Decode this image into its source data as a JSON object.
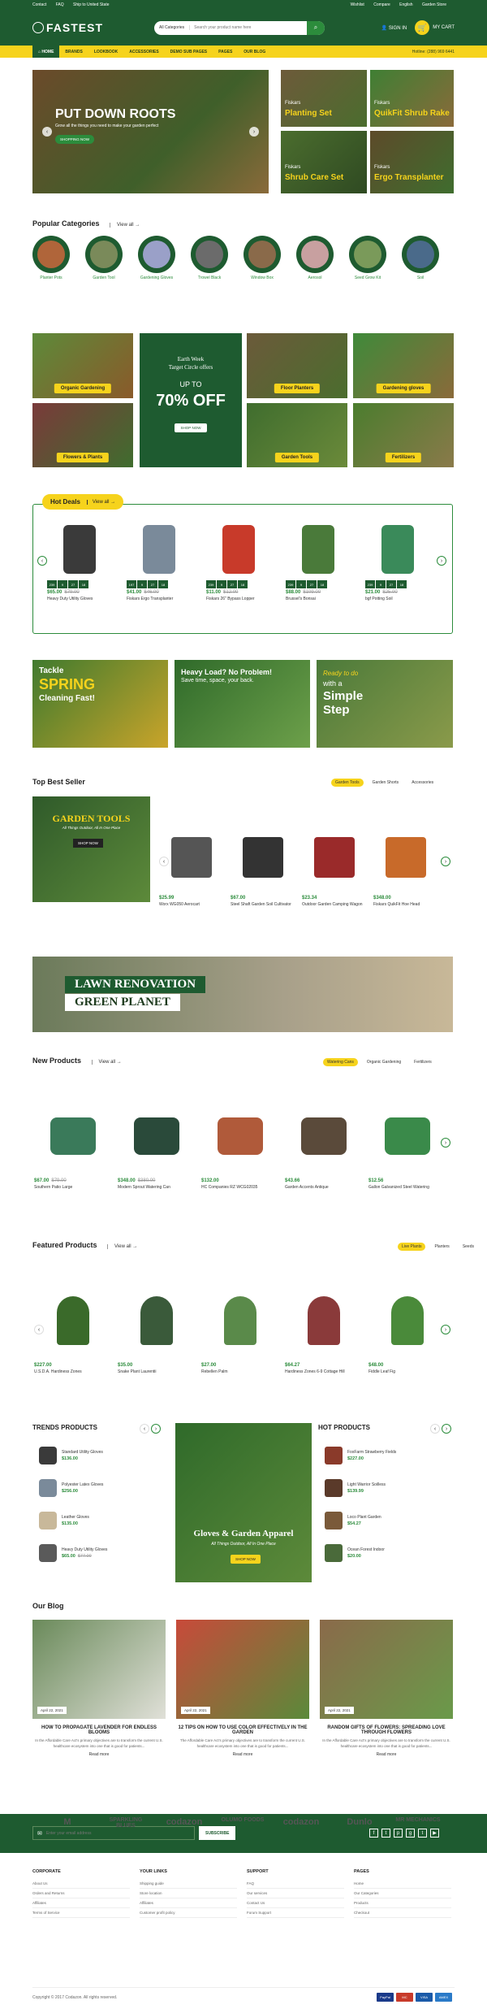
{
  "topbar": {
    "contact": "Contact",
    "faq": "FAQ",
    "ship": "Ship to United State",
    "wishlist": "Wishlist",
    "compare": "Compare",
    "language": "English",
    "store": "Garden Store"
  },
  "header": {
    "logo": "FASTEST",
    "search_category": "All Categories",
    "search_placeholder": "Search your product name here",
    "signin": "SIGN IN",
    "cart": "MY CART"
  },
  "nav": {
    "items": [
      "HOME",
      "BRANDS",
      "LOOKBOOK",
      "ACCESSORIES",
      "DEMO SUB PAGES",
      "PAGES",
      "OUR BLOG"
    ],
    "phone": "Hotline: (288) 969 6441"
  },
  "hero": {
    "title": "PUT DOWN ROOTS",
    "subtitle": "Grow all the things you need to make your garden perfect",
    "button": "SHOPPING NOW"
  },
  "side_tiles": [
    {
      "brand": "Fiskars",
      "label": "Planting Set"
    },
    {
      "brand": "Fiskars",
      "label": "QuikFit Shrub Rake"
    },
    {
      "brand": "Fiskars",
      "label": "Shrub Care Set"
    },
    {
      "brand": "Fiskars",
      "label": "Ergo Transplanter"
    }
  ],
  "popular": {
    "title": "Popular Categories",
    "view_all": "View all",
    "items": [
      "Planter Pots",
      "Garden Tool",
      "Gardening Gloves",
      "Trowel Black",
      "Window Box",
      "Aerosol",
      "Seed Grow Kit",
      "Soil"
    ]
  },
  "promo_tiles": [
    "Organic Gardening",
    "Floor Planters",
    "Gardening gloves",
    "Flowers & Plants",
    "Garden Tools",
    "Fertilizers"
  ],
  "promo": {
    "line1": "Earth Week",
    "line2": "Target Circle offers",
    "upto": "UP TO",
    "off": "70% OFF",
    "button": "SHOP NOW"
  },
  "hot_deals": {
    "title": "Hot Deals",
    "view_all": "View all",
    "countdown_labels": [
      "Days",
      "Hours",
      "Mins",
      "Secs"
    ],
    "items": [
      {
        "price": "$65.00",
        "old": "$79.00",
        "name": "Heavy Duty Utility Gloves",
        "cd": [
          "239",
          "9",
          "27",
          "18"
        ]
      },
      {
        "price": "$41.00",
        "old": "$46.00",
        "name": "Fiskars Ergo Transplanter",
        "cd": [
          "197",
          "9",
          "27",
          "18"
        ]
      },
      {
        "price": "$11.00",
        "old": "$12.00",
        "name": "Fiskars 26\" Bypass Lopper",
        "cd": [
          "239",
          "9",
          "27",
          "18"
        ]
      },
      {
        "price": "$88.00",
        "old": "$109.00",
        "name": "Brussel's Bonsai",
        "cd": [
          "239",
          "9",
          "27",
          "18"
        ]
      },
      {
        "price": "$21.00",
        "old": "$25.00",
        "name": "bgf Potting Soil",
        "cd": [
          "239",
          "9",
          "27",
          "18"
        ]
      }
    ]
  },
  "banners3": [
    {
      "a": "Tackle",
      "b": "SPRING",
      "c": "Cleaning Fast!"
    },
    {
      "a": "Heavy Load? No Problem!",
      "b": "Save time, space, your back."
    },
    {
      "a": "Ready to do",
      "b": "with a",
      "c": "Simple Step"
    }
  ],
  "best": {
    "title": "Top Best Seller",
    "tabs": [
      "Garden Tools",
      "Garden Shorts",
      "Accessories"
    ],
    "banner_title": "GARDEN TOOLS",
    "banner_sub": "All Things Outdoor, All In One Place",
    "banner_btn": "SHOP NOW",
    "items": [
      {
        "price": "$25.99",
        "name": "Worx WG050 Aerocart"
      },
      {
        "price": "$67.00",
        "name": "Steel Shaft Garden Soil Cultivator"
      },
      {
        "price": "$23.34",
        "name": "Outdoor Garden Camping Wagon"
      },
      {
        "price": "$348.00",
        "name": "Fiskars QuikFit Hoe Head"
      }
    ]
  },
  "lawn": {
    "l1": "LAWN RENOVATION",
    "l2": "GREEN PLANET"
  },
  "newp": {
    "title": "New Products",
    "view_all": "View all",
    "tabs": [
      "Watering Cans",
      "Organic Gardening",
      "Fertilizers"
    ],
    "items": [
      {
        "price": "$67.00",
        "old": "$79.00",
        "name": "Southern Patio Large"
      },
      {
        "price": "$348.00",
        "old": "$380.00",
        "name": "Modern Sprout Watering Can"
      },
      {
        "price": "$132.00",
        "old": "",
        "name": "HC Companies RZ WCG02035"
      },
      {
        "price": "$43.66",
        "old": "",
        "name": "Garden Accents Antique"
      },
      {
        "price": "$12.56",
        "old": "",
        "name": "Gallon Galvanized Steel Watering"
      }
    ]
  },
  "featured": {
    "title": "Featured Products",
    "view_all": "View all",
    "tabs": [
      "Live Plants",
      "Planters",
      "Seeds"
    ],
    "items": [
      {
        "price": "$227.00",
        "name": "U.S.D.A. Hardiness Zones"
      },
      {
        "price": "$35.00",
        "name": "Snake Plant Laurentii"
      },
      {
        "price": "$27.00",
        "name": "Rebellen Palm"
      },
      {
        "price": "$64.27",
        "name": "Hardiness Zones 6-9 Cottage Hill"
      },
      {
        "price": "$48.00",
        "name": "Fiddle Leaf Fig"
      }
    ]
  },
  "trends": {
    "title": "TRENDS PRODUCTS",
    "items": [
      {
        "name": "Standard Utility Gloves",
        "price": "$136.00",
        "old": ""
      },
      {
        "name": "Polyester Latex Gloves",
        "price": "$256.00",
        "old": ""
      },
      {
        "name": "Leather Gloves",
        "price": "$135.00",
        "old": ""
      },
      {
        "name": "Heavy Duty Utility Gloves",
        "price": "$65.00",
        "old": "$77.00"
      }
    ]
  },
  "gloves": {
    "title": "Gloves & Garden Apparel",
    "sub": "All Things Outdoor, All In One Place",
    "btn": "SHOP NOW"
  },
  "hot": {
    "title": "HOT PRODUCTS",
    "items": [
      {
        "name": "FoxFarm Strawberry Fields",
        "price": "$227.00"
      },
      {
        "name": "Light Warrior Soilless",
        "price": "$139.99"
      },
      {
        "name": "Loco Plant Garden",
        "price": "$54.27"
      },
      {
        "name": "Ocean Forest Indoor",
        "price": "$20.00"
      }
    ]
  },
  "blog": {
    "title": "Our Blog",
    "items": [
      {
        "date": "April 22, 2021",
        "title": "HOW TO PROPAGATE LAVENDER FOR ENDLESS BLOOMS",
        "desc": "In the Affordable Care Act's primary objectives are to transform the current U.S. healthcare ecosystem into one that is good for patients...",
        "more": "Read more"
      },
      {
        "date": "April 22, 2021",
        "title": "12 TIPS ON HOW TO USE COLOR EFFECTIVELY IN THE GARDEN",
        "desc": "The Affordable Care Act's primary objectives are to transform the current U.S. healthcare ecosystem into one that is good for patients...",
        "more": "Read more"
      },
      {
        "date": "April 22, 2021",
        "title": "RANDOM GIFTS OF FLOWERS: SPREADING LOVE THROUGH FLOWERS",
        "desc": "In the Affordable Care Act's primary objectives are to transform the current U.S. healthcare ecosystem into one that is good for patients...",
        "more": "Read more"
      }
    ]
  },
  "brands": [
    "M",
    "SPARKLING BLUES",
    "codazon",
    "OLUMO FOODS",
    "codazon",
    "Dunlo",
    "MR MECHANICS"
  ],
  "newsletter": {
    "placeholder": "Enter your email address",
    "button": "SUBSCRIBE"
  },
  "footer": {
    "cols": [
      {
        "h": "CORPORATE",
        "items": [
          "About Us",
          "Orders and Returns",
          "Affiliates",
          "Terms of Service"
        ]
      },
      {
        "h": "YOUR LINKS",
        "items": [
          "Shipping guide",
          "Store location",
          "Affiliates",
          "Customer profit policy"
        ]
      },
      {
        "h": "SUPPORT",
        "items": [
          "FAQ",
          "Our services",
          "Contact Us",
          "Forum Support"
        ]
      },
      {
        "h": "PAGES",
        "items": [
          "Home",
          "Our Categories",
          "Products",
          "Checkout"
        ]
      }
    ],
    "copyright": "Copyright © 2017 Codazon. All rights reserved.",
    "payments": [
      "PayPal",
      "MC",
      "VISA",
      "AMEX"
    ]
  }
}
